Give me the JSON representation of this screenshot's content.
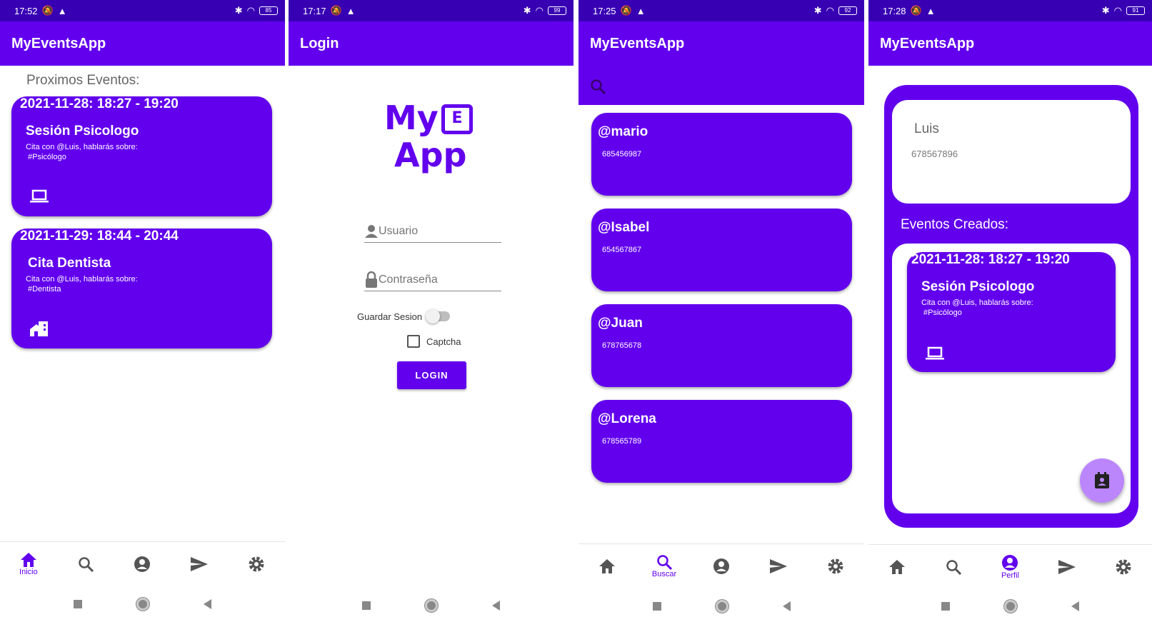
{
  "app_title": "MyEventsApp",
  "colors": {
    "primary": "#6200ee",
    "primary_dark": "#3700b3",
    "fab": "#bb86fc"
  },
  "nav_labels": {
    "home": "Inicio",
    "search": "Buscar",
    "profile": "Perfil"
  },
  "screen_home": {
    "status": {
      "time": "17:52",
      "battery": "85"
    },
    "section_title": "Proximos Eventos:",
    "events": [
      {
        "datetime": "2021-11-28: 18:27 - 19:20",
        "title": "Sesión Psicologo",
        "desc": "Cita con @Luis, hablarás sobre:",
        "tag": "#Psicólogo",
        "icon": "laptop-icon"
      },
      {
        "datetime": "2021-11-29: 18:44 - 20:44",
        "title": "Cita Dentista",
        "desc": "Cita con @Luis, hablarás sobre:",
        "tag": "#Dentista",
        "icon": "home-work-icon"
      }
    ]
  },
  "screen_login": {
    "status": {
      "time": "17:17",
      "battery": "99"
    },
    "title": "Login",
    "logo": {
      "line1": "My",
      "badge": "E",
      "line2": "App"
    },
    "username_placeholder": "Usuario",
    "password_placeholder": "Contraseña",
    "save_session_label": "Guardar Sesion",
    "captcha_label": "Captcha",
    "login_button": "LOGIN"
  },
  "screen_search": {
    "status": {
      "time": "17:25",
      "battery": "92"
    },
    "users": [
      {
        "handle": "@mario",
        "phone": "685456987"
      },
      {
        "handle": "@Isabel",
        "phone": "654567867"
      },
      {
        "handle": "@Juan",
        "phone": "678765678"
      },
      {
        "handle": "@Lorena",
        "phone": "678565789"
      }
    ]
  },
  "screen_profile": {
    "status": {
      "time": "17:28",
      "battery": "91"
    },
    "name": "Luis",
    "phone": "678567896",
    "section_title": "Eventos Creados:",
    "event": {
      "datetime": "2021-11-28: 18:27 - 19:20",
      "title": "Sesión Psicologo",
      "desc": "Cita con @Luis, hablarás sobre:",
      "tag": "#Psicólogo",
      "icon": "laptop-icon"
    }
  }
}
